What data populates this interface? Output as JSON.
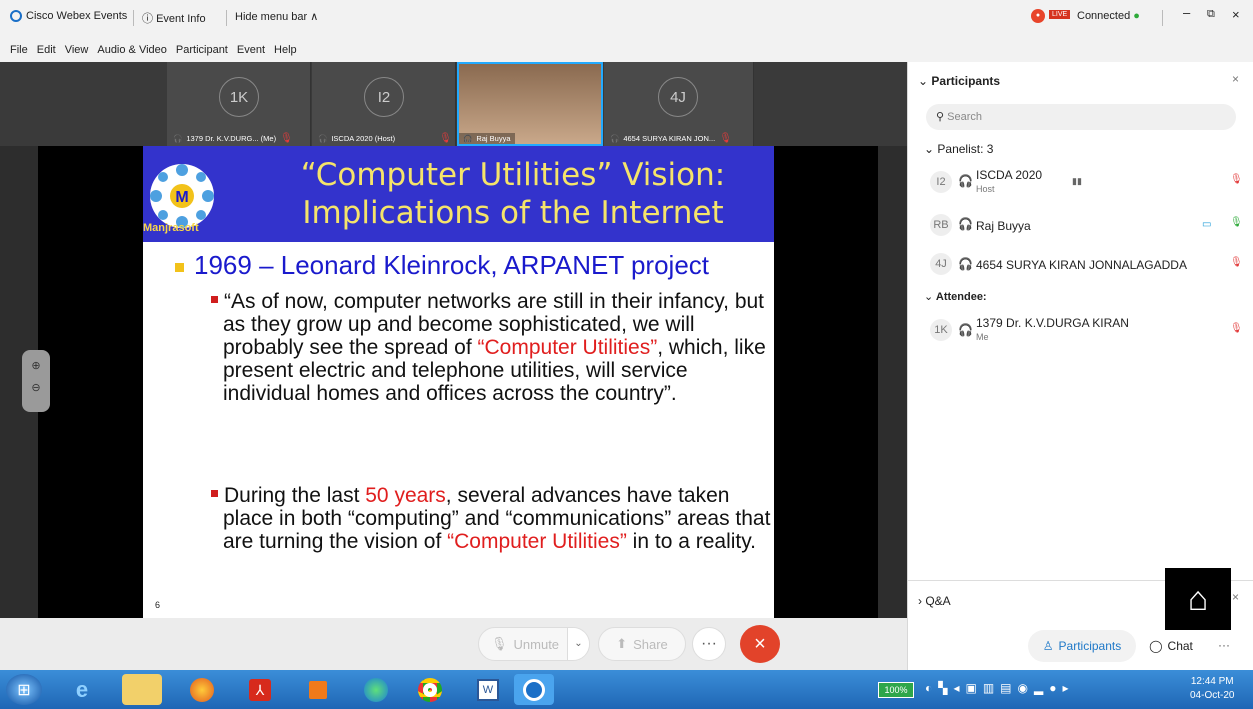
{
  "titlebar": {
    "app": "Cisco Webex Events",
    "event_info": "Event Info",
    "hide_menu": "Hide menu bar",
    "live": "LIVE",
    "connected": "Connected"
  },
  "menu": [
    "File",
    "Edit",
    "View",
    "Audio & Video",
    "Participant",
    "Event",
    "Help"
  ],
  "thumbs": [
    {
      "initials": "1K",
      "label": "1379 Dr. K.V.DURG... (Me)"
    },
    {
      "initials": "I2",
      "label": "ISCDA 2020 (Host)"
    },
    {
      "initials": "",
      "label": "Raj Buyya"
    },
    {
      "initials": "4J",
      "label": "4654 SURYA KIRAN JON..."
    }
  ],
  "slide": {
    "title1": "“Computer Utilities” Vision:",
    "title2": "Implications of the Internet",
    "logo_text": "Manjrasoft",
    "bullet": "1969 – Leonard Kleinrock, ARPANET project",
    "p1a": "“As of now, computer networks are still in their infancy, but as they grow up and become sophisticated, we will probably see the spread of ",
    "p1red": "“Computer Utilities”",
    "p1b": ", which, like present electric and telephone utilities, will service individual homes and offices across the country”.",
    "p2a": "During the last ",
    "p2red": "50 years",
    "p2b": ", several advances have taken place in both “computing” and “communications” areas that are turning the vision of ",
    "p2red2": "“Computer Utilities”",
    "p2c": " in to a reality.",
    "page": "6"
  },
  "controls": {
    "unmute": "Unmute",
    "share": "Share",
    "more": "···"
  },
  "panel": {
    "title": "Participants",
    "search_placeholder": "Search",
    "panelist_header": "Panelist: 3",
    "panelists": [
      {
        "initials": "I2",
        "name": "ISCDA 2020",
        "role": "Host"
      },
      {
        "initials": "RB",
        "name": "Raj Buyya",
        "role": ""
      },
      {
        "initials": "4J",
        "name": "4654 SURYA KIRAN JONNALAGADDA",
        "role": ""
      }
    ],
    "attendee_header": "Attendee:",
    "attendees": [
      {
        "initials": "1K",
        "name": "1379 Dr. K.V.DURGA KIRAN",
        "role": "Me"
      }
    ],
    "qa": "Q&A",
    "participants_btn": "Participants",
    "chat_btn": "Chat"
  },
  "taskbar": {
    "battery": "100%",
    "time": "12:44 PM",
    "date": "04-Oct-20"
  }
}
